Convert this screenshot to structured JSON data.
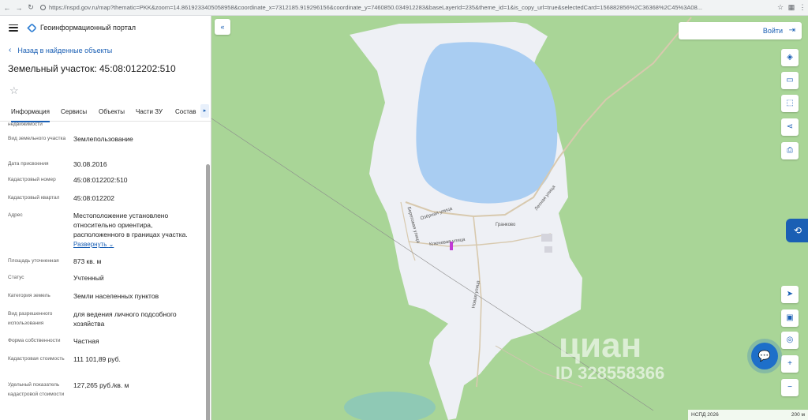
{
  "browser": {
    "url": "https://nspd.gov.ru/map?thematic=PKK&zoom=14.8619233405058958&coordinate_x=7312185.919296156&coordinate_y=7460850.034912283&baseLayerId=235&theme_id=1&is_copy_url=true&selectedCard=156882856%2C36368%2C45%3A08..."
  },
  "header": {
    "portal_name": "Геоинформационный портал"
  },
  "nav": {
    "back_label": "Назад в найденные объекты"
  },
  "object": {
    "title": "Земельный участок: 45:08:012202:510"
  },
  "tabs": [
    {
      "label": "Информация",
      "active": true
    },
    {
      "label": "Сервисы"
    },
    {
      "label": "Объекты"
    },
    {
      "label": "Части ЗУ"
    },
    {
      "label": "Состав"
    }
  ],
  "attributes": {
    "top_fragment": "недвижимости",
    "rows": [
      {
        "label": "Вид земельного участка",
        "value": "Землепользование"
      },
      {
        "label": "Дата присвоения",
        "value": "30.08.2016"
      },
      {
        "label": "Кадастровый номер",
        "value": "45:08:012202:510"
      },
      {
        "label": "Кадастровый квартал",
        "value": "45:08:012202"
      },
      {
        "label": "Адрес",
        "value": "Местоположение установлено относительно ориентира, расположенного в границах участка.",
        "more": "Развернуть"
      },
      {
        "label": "Площадь уточненная",
        "value": "873 кв. м"
      },
      {
        "label": "Статус",
        "value": "Учтенный"
      },
      {
        "label": "Категория земель",
        "value": "Земли населенных пунктов"
      },
      {
        "label": "Вид разрешенного использования",
        "value": "для ведения личного подсобного хозяйства"
      },
      {
        "label": "Форма собственности",
        "value": "Частная"
      },
      {
        "label": "Кадастровая стоимость",
        "value": "111 101,89 руб."
      },
      {
        "label": "Удельный показатель кадастровой стоимости",
        "value": "127,265 руб./кв. м"
      }
    ]
  },
  "map": {
    "login_label": "Войти",
    "village_label": "Гранково",
    "street_labels": [
      "Озёрная улица",
      "Новая улица",
      "Береговая улица",
      "Ключевая улица",
      "Лесная улица"
    ],
    "scale_left": "НСПД 2026",
    "scale_right": "200 м",
    "watermark_brand": "циан",
    "watermark_id": "ID 328558366",
    "colors": {
      "forest": "#a9d597",
      "open_land": "#eef0f5",
      "lake": "#a9cdf2",
      "accent": "#1a5fb4"
    }
  },
  "tools": {
    "layers": "layers-icon",
    "ruler": "ruler-icon",
    "select": "select-area-icon",
    "share": "share-icon",
    "print": "print-icon",
    "locate": "locate-icon",
    "minimap": "minimap-icon",
    "geo": "geolocation-icon",
    "zoom_in": "+",
    "zoom_out": "−"
  }
}
